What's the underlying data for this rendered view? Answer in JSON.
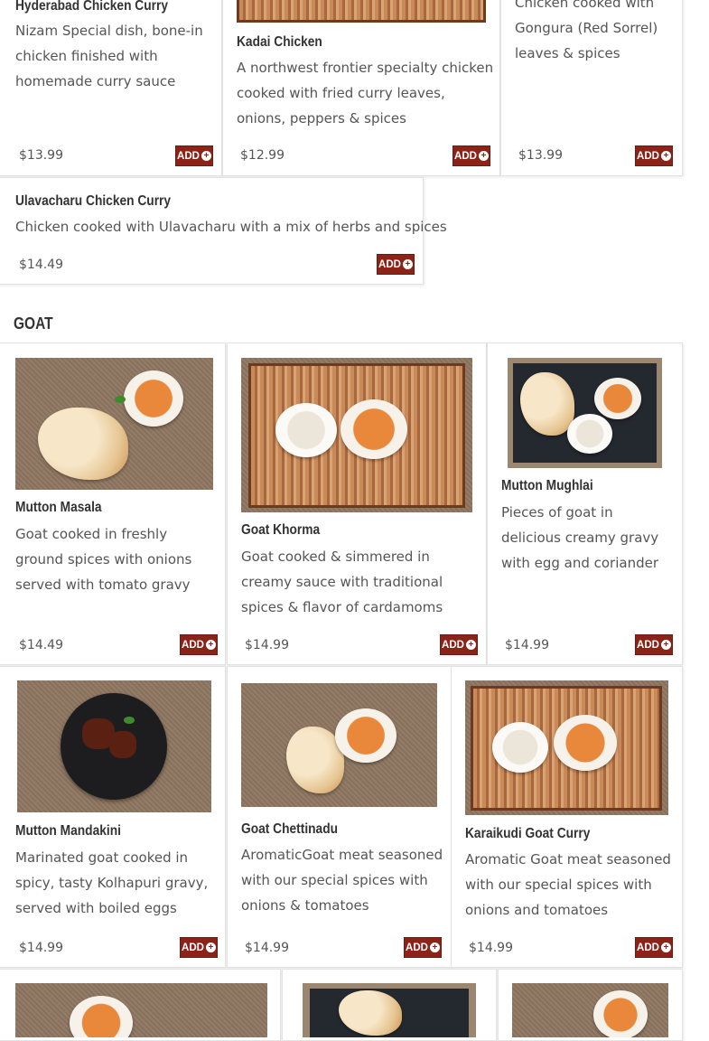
{
  "add_label": "ADD",
  "section_goat": "GOAT",
  "items": {
    "hyderabad": {
      "title": "Hyderabad Chicken Curry",
      "desc": "Nizam Special dish, bone-in chicken finished with homemade curry sauce",
      "price": "$13.99"
    },
    "kadai": {
      "title": "Kadai Chicken",
      "desc": "A northwest frontier specialty chicken cooked with fried curry leaves, onions, peppers & spices",
      "price": "$12.99"
    },
    "gongura": {
      "title": "",
      "desc": "Chicken cooked with Gongura (Red Sorrel) leaves & spices",
      "price": "$13.99"
    },
    "ulavacharu": {
      "title": "Ulavacharu Chicken Curry",
      "desc": "Chicken cooked with Ulavacharu with a mix of herbs and spices",
      "price": "$14.49"
    },
    "mutton_masala": {
      "title": "Mutton Masala",
      "desc": "Goat cooked in freshly ground spices with onions served with tomato gravy",
      "price": "$14.49"
    },
    "goat_khorma": {
      "title": "Goat Khorma",
      "desc": "Goat cooked & simmered in creamy sauce with traditional spices & flavor of cardamoms",
      "price": "$14.99"
    },
    "mutton_mughlai": {
      "title": "Mutton Mughlai",
      "desc": "Pieces of goat in delicious creamy gravy with egg and coriander",
      "price": "$14.99"
    },
    "mutton_mandakini": {
      "title": "Mutton Mandakini",
      "desc": "Marinated goat cooked in spicy, tasty Kolhapuri gravy, served with boiled eggs",
      "price": "$14.99"
    },
    "goat_chettinadu": {
      "title": "Goat Chettinadu",
      "desc": "AromaticGoat meat seasoned with our special spices with onions & tomatoes",
      "price": "$14.99"
    },
    "karaikudi": {
      "title": "Karaikudi Goat Curry",
      "desc": "Aromatic Goat meat seasoned with our special spices with onions and tomatoes",
      "price": "$14.99"
    }
  }
}
